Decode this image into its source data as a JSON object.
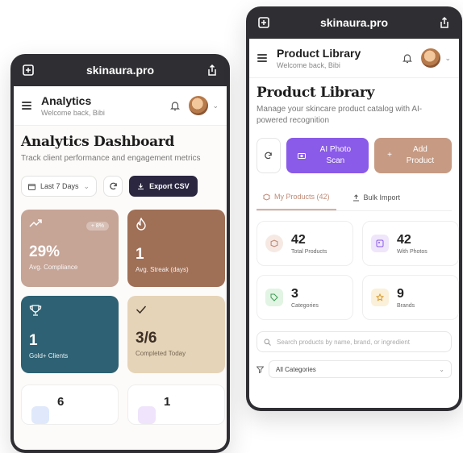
{
  "left": {
    "url": "skinaura.pro",
    "header": {
      "title": "Analytics",
      "subtitle": "Welcome back, Bibi"
    },
    "page_title": "Analytics Dashboard",
    "page_subtitle": "Track client performance and engagement metrics",
    "date_filter": "Last 7 Days",
    "export_label": "Export CSV",
    "cards": [
      {
        "value": "29%",
        "label": "Avg. Compliance",
        "badge": "+ 8%"
      },
      {
        "value": "1",
        "label": "Avg. Streak (days)"
      },
      {
        "value": "1",
        "label": "Gold+ Clients"
      },
      {
        "value": "3/6",
        "label": "Completed Today"
      }
    ],
    "mini": [
      {
        "value": "6"
      },
      {
        "value": "1"
      }
    ]
  },
  "right": {
    "url": "skinaura.pro",
    "header": {
      "title": "Product Library",
      "subtitle": "Welcome back, Bibi"
    },
    "page_title": "Product Library",
    "page_subtitle": "Manage your skincare product catalog with AI-powered recognition",
    "ai_button": "AI Photo Scan",
    "add_button": "Add Product",
    "tabs": {
      "mine": "My Products (42)",
      "bulk": "Bulk Import"
    },
    "stats": [
      {
        "value": "42",
        "label": "Total Products",
        "color": "#f6e9e4"
      },
      {
        "value": "42",
        "label": "With Photos",
        "color": "#efe6fb"
      },
      {
        "value": "3",
        "label": "Categories",
        "color": "#e2f4e3"
      },
      {
        "value": "9",
        "label": "Brands",
        "color": "#fbf0d9"
      }
    ],
    "search_placeholder": "Search products by name, brand, or ingredient",
    "filter_label": "All Categories"
  },
  "colors": {
    "accent_purple": "#8a5ae8",
    "accent_tan": "#c69a83",
    "dark_button": "#2b2740",
    "teal": "#2d6173"
  }
}
